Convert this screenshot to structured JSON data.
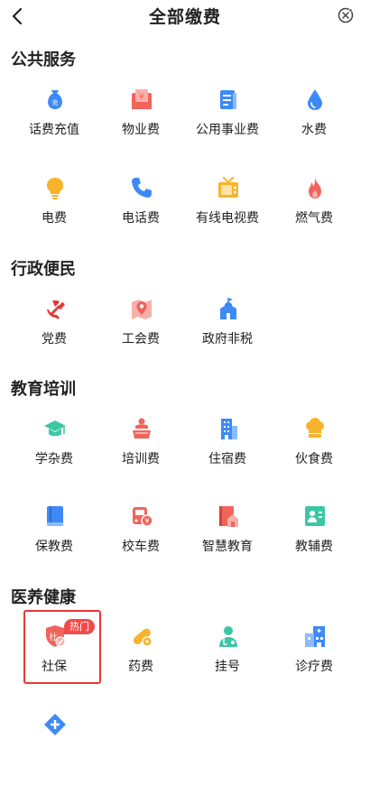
{
  "header": {
    "title": "全部缴费"
  },
  "sections": [
    {
      "title": "公共服务",
      "items": [
        {
          "label": "话费充值",
          "icon": "phone-recharge-icon",
          "color": "#3d8af7"
        },
        {
          "label": "物业费",
          "icon": "property-fee-icon",
          "color": "#f0645c"
        },
        {
          "label": "公用事业费",
          "icon": "utilities-icon",
          "color": "#3d8af7"
        },
        {
          "label": "水费",
          "icon": "water-drop-icon",
          "color": "#3d8af7"
        },
        {
          "label": "电费",
          "icon": "light-bulb-icon",
          "color": "#f7b32b"
        },
        {
          "label": "电话费",
          "icon": "telephone-icon",
          "color": "#3d8af7"
        },
        {
          "label": "有线电视费",
          "icon": "television-icon",
          "color": "#f7b32b"
        },
        {
          "label": "燃气费",
          "icon": "flame-icon",
          "color": "#f0645c"
        }
      ]
    },
    {
      "title": "行政便民",
      "items": [
        {
          "label": "党费",
          "icon": "party-emblem-icon",
          "color": "#e53935"
        },
        {
          "label": "工会费",
          "icon": "map-pin-icon",
          "color": "#f0645c"
        },
        {
          "label": "政府非税",
          "icon": "government-building-icon",
          "color": "#3d8af7"
        }
      ]
    },
    {
      "title": "教育培训",
      "items": [
        {
          "label": "学杂费",
          "icon": "graduation-cap-icon",
          "color": "#3cc7a4"
        },
        {
          "label": "培训费",
          "icon": "lectern-icon",
          "color": "#f0645c"
        },
        {
          "label": "住宿费",
          "icon": "dormitory-building-icon",
          "color": "#3d8af7"
        },
        {
          "label": "伙食费",
          "icon": "chef-hat-icon",
          "color": "#f7b32b"
        },
        {
          "label": "保教费",
          "icon": "book-icon",
          "color": "#3d8af7"
        },
        {
          "label": "校车费",
          "icon": "school-bus-icon",
          "color": "#f0645c"
        },
        {
          "label": "智慧教育",
          "icon": "smart-education-icon",
          "color": "#f0645c"
        },
        {
          "label": "教辅费",
          "icon": "teaching-aid-icon",
          "color": "#3cc7a4"
        }
      ]
    },
    {
      "title": "医养健康",
      "items": [
        {
          "label": "社保",
          "icon": "social-security-shield-icon",
          "color": "#f0645c"
        },
        {
          "label": "药费",
          "icon": "pill-icon",
          "color": "#f7b32b"
        },
        {
          "label": "挂号",
          "icon": "doctor-icon",
          "color": "#3cc7a4"
        },
        {
          "label": "诊疗费",
          "icon": "hospital-icon",
          "color": "#3d8af7"
        },
        {
          "label": "",
          "icon": "health-diamond-icon",
          "color": "#3d8af7"
        }
      ]
    }
  ],
  "badge": {
    "hot": "热门"
  }
}
